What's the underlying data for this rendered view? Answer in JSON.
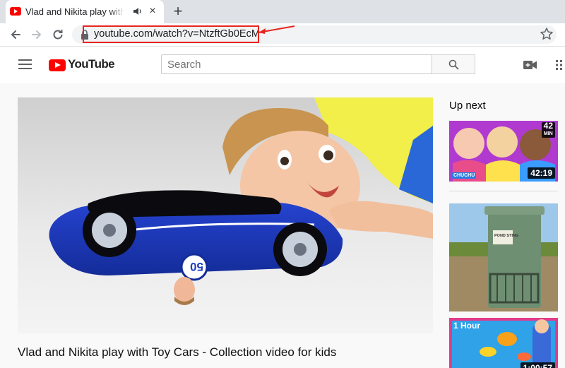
{
  "browser": {
    "tab_title": "Vlad and Nikita play with T",
    "tab_close": "×",
    "new_tab": "+",
    "url": "youtube.com/watch?v=NtzftGb0EcM"
  },
  "youtube": {
    "logo_text": "YouTube",
    "search_placeholder": "Search"
  },
  "video": {
    "plate_number": "50",
    "title": "Vlad and Nikita play with Toy Cars - Collection video for kids"
  },
  "sidebar": {
    "heading": "Up next",
    "items": [
      {
        "thumb_corner": "42",
        "thumb_corner_sub": "MIN",
        "duration": "42:19",
        "channel_mark": "CHUCHU"
      },
      {
        "sign_text": "POND STING"
      },
      {
        "thumb_text": "1 Hour",
        "duration": "1:00:57"
      }
    ]
  },
  "colors": {
    "yt_red": "#ff0000",
    "annotation_red": "#e8251f",
    "car_blue": "#1f3fbf",
    "shirt_yellow": "#f2ee4a"
  }
}
